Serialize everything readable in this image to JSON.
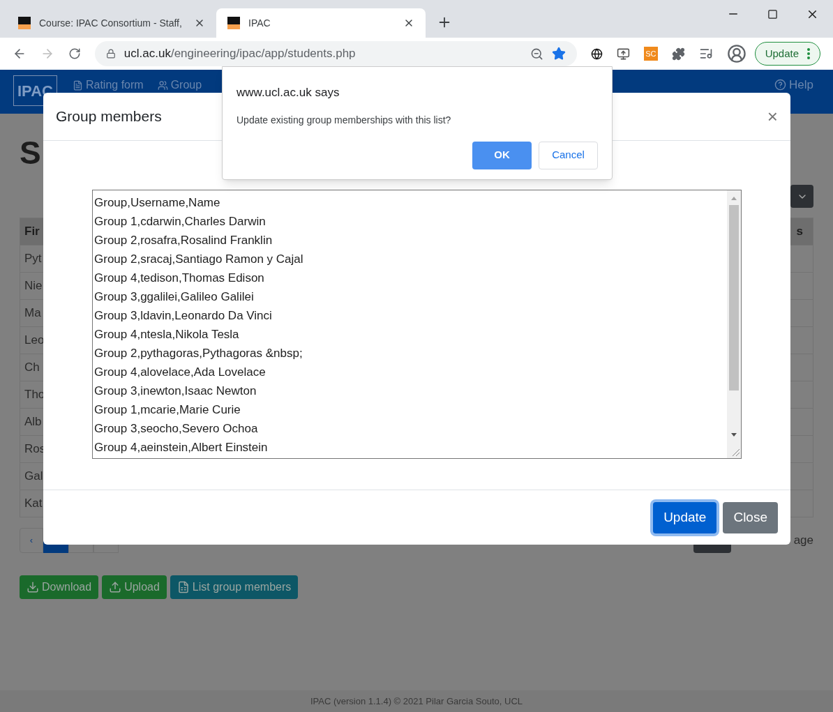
{
  "browser": {
    "tabs": [
      {
        "title": "Course: IPAC Consortium - Staff,",
        "selected": false
      },
      {
        "title": "IPAC",
        "selected": true
      }
    ],
    "address_host": "ucl.ac.uk",
    "address_path": "/engineering/ipac/app/students.php",
    "bookmarked": true,
    "extension_badge": "SC",
    "update_button": "Update"
  },
  "navbar": {
    "logo": "IPAC",
    "links": [
      "Rating form",
      "Group"
    ],
    "help": "Help"
  },
  "page": {
    "heading": "S",
    "table": {
      "first_header": "Fir",
      "last_header": "s",
      "first_cells": [
        "Pyt",
        "Nie",
        "Ma",
        "Leo",
        "Ch",
        "Tho",
        "Alb",
        "Ros",
        "Gal",
        "Kat"
      ]
    },
    "pagination": {
      "prev": "‹",
      "pages": [
        {
          "selected": true
        },
        {
          "selected": false
        },
        {
          "selected": false
        }
      ]
    },
    "page_text": "age",
    "buttons": [
      {
        "label": "Download",
        "kind": "download"
      },
      {
        "label": "Upload",
        "kind": "upload"
      },
      {
        "label": "List group members",
        "kind": "list"
      }
    ]
  },
  "footer": "IPAC (version 1.1.4) © 2021 Pilar Garcia Souto, UCL",
  "modal": {
    "title": "Group members",
    "close": "×",
    "text_lines": [
      "Group,Username,Name",
      "Group 1,cdarwin,Charles Darwin",
      "Group 2,rosafra,Rosalind Franklin",
      "Group 2,sracaj,Santiago Ramon y Cajal",
      "Group 4,tedison,Thomas Edison",
      "Group 3,ggalilei,Galileo Galilei",
      "Group 3,ldavin,Leonardo Da Vinci",
      "Group 4,ntesla,Nikola Tesla",
      "Group 2,pythagoras,Pythagoras &nbsp;",
      "Group 4,alovelace,Ada Lovelace",
      "Group 3,inewton,Isaac Newton",
      "Group 1,mcarie,Marie Curie",
      "Group 3,seocho,Severo Ochoa",
      "Group 4,aeinstein,Albert Einstein"
    ],
    "buttons": [
      {
        "label": "Update",
        "kind": "primary"
      },
      {
        "label": "Close",
        "kind": "secondary"
      }
    ]
  },
  "alert": {
    "origin": "www.ucl.ac.uk says",
    "message": "Update existing group memberships with this list?",
    "ok": "OK",
    "cancel": "Cancel"
  }
}
